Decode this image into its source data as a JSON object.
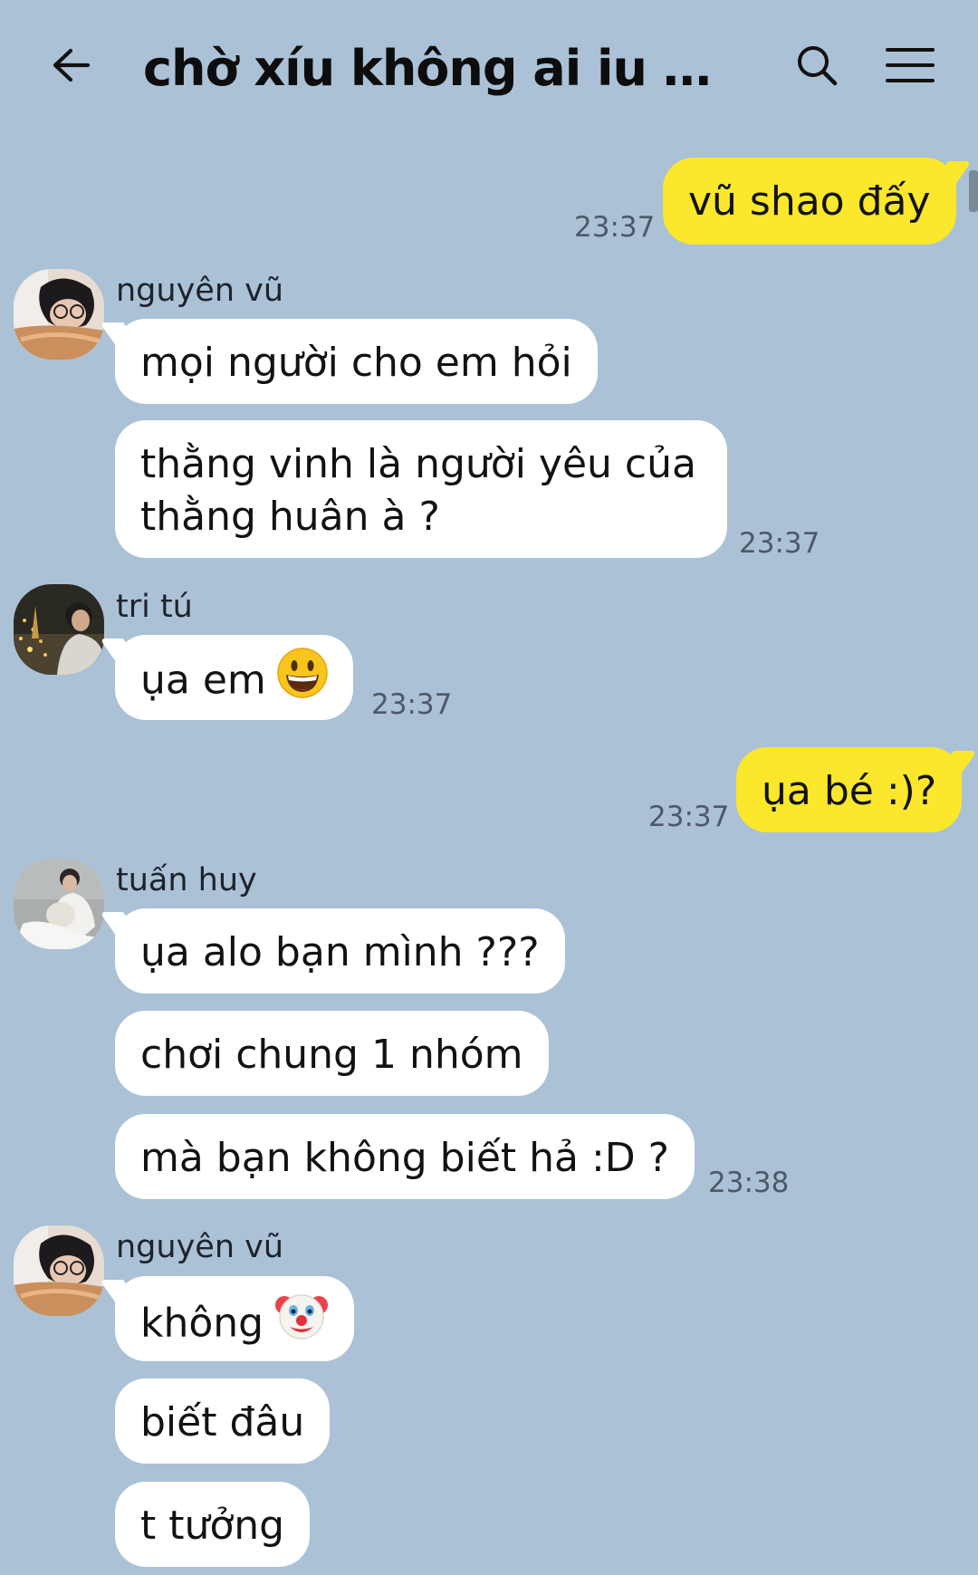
{
  "header": {
    "title": "chờ xíu không ai iu em..."
  },
  "colors": {
    "background": "#abc1d6",
    "outgoing_bubble": "#fbe72b",
    "incoming_bubble": "#ffffff"
  },
  "icons": {
    "back": "back-arrow-icon",
    "search": "search-icon",
    "menu": "menu-icon"
  },
  "messages": [
    {
      "direction": "out",
      "text": "vũ shao đấy",
      "time": "23:37"
    },
    {
      "direction": "in",
      "sender": "nguyên vũ",
      "text": "mọi người cho em hỏi"
    },
    {
      "direction": "in",
      "text": "thằng vinh là người yêu của thằng huân à ?",
      "time": "23:37"
    },
    {
      "direction": "in",
      "sender": "tri tú",
      "text": "ụa em",
      "emoji": "grinning-face",
      "time": "23:37"
    },
    {
      "direction": "out",
      "text": "ụa bé :)?",
      "time": "23:37"
    },
    {
      "direction": "in",
      "sender": "tuấn huy",
      "text": "ụa alo bạn mình ???"
    },
    {
      "direction": "in",
      "text": "chơi chung 1 nhóm"
    },
    {
      "direction": "in",
      "text": "mà bạn không biết hả :D ?",
      "time": "23:38"
    },
    {
      "direction": "in",
      "sender": "nguyên vũ",
      "text": "không",
      "emoji": "clown-face"
    },
    {
      "direction": "in",
      "text": "biết đâu"
    },
    {
      "direction": "in",
      "text": "t tưởng"
    }
  ]
}
